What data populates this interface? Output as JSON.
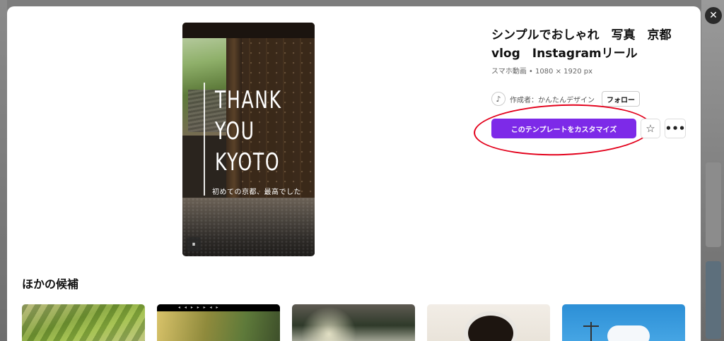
{
  "template": {
    "title": "シンプルでおしゃれ　写真　京都\nvlog　Instagramリール",
    "subtitle": "スマホ動画 • 1080 × 1920 px",
    "author_label": "作成者：かんたんデザイン",
    "follow_label": "フォロー",
    "customize_label": "このテンプレートをカスタマイズ",
    "star_glyph": "☆",
    "more_glyph": "•••",
    "close_glyph": "✕"
  },
  "preview": {
    "headline": "THANK\nYOU\nKYOTO",
    "caption": "初めての京都、最高でした",
    "pause_glyph": "⏸"
  },
  "related": {
    "title": "ほかの候補",
    "thumb2_bar": "◂ ◂ ▸ ▸ ▸ ◂ ▸"
  },
  "colors": {
    "accent": "#7d2ae8",
    "highlight": "#e3001b"
  }
}
